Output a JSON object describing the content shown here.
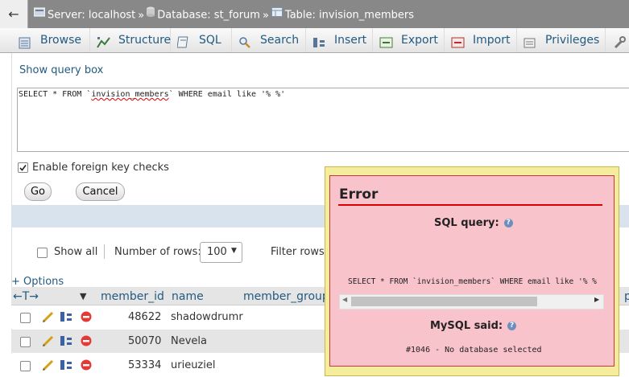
{
  "breadcrumb": {
    "server": "Server: localhost",
    "database": "Database: st_forum",
    "table": "Table: invision_members",
    "sep": "»"
  },
  "tabs": [
    {
      "label": "Browse",
      "icon": "browse-icon"
    },
    {
      "label": "Structure",
      "icon": "structure-icon"
    },
    {
      "label": "SQL",
      "icon": "sql-icon"
    },
    {
      "label": "Search",
      "icon": "search-icon"
    },
    {
      "label": "Insert",
      "icon": "insert-icon"
    },
    {
      "label": "Export",
      "icon": "export-icon"
    },
    {
      "label": "Import",
      "icon": "import-icon"
    },
    {
      "label": "Privileges",
      "icon": "privileges-icon"
    }
  ],
  "query": {
    "show_query_box": "Show query box",
    "sql_before": "SELECT * FROM `",
    "sql_table": "invision_members",
    "sql_after": "` WHERE email like '% %'",
    "fk_label": "Enable foreign key checks",
    "go_label": "Go",
    "cancel_label": "Cancel"
  },
  "nav": {
    "show_all": "Show all",
    "rows_label": "Number of rows:",
    "rows_value": "100",
    "filter_label": "Filter rows:",
    "options": "+ Options"
  },
  "table": {
    "columns": [
      "member_id",
      "name",
      "member_group_"
    ],
    "extra_col": "p",
    "rows": [
      {
        "member_id": "48622",
        "name": "shadowdrumr"
      },
      {
        "member_id": "50070",
        "name": "Nevela"
      },
      {
        "member_id": "53334",
        "name": "urieuziel"
      }
    ]
  },
  "error": {
    "title": "Error",
    "sql_query_label": "SQL query:",
    "sql_query": "SELECT * FROM `invision_members` WHERE email like '% %",
    "mysql_said_label": "MySQL said:",
    "message": "#1046 - No database selected"
  },
  "colors": {
    "link": "#235a81",
    "dialog_bg": "#f9c3cb",
    "dialog_border": "#f5ec9c",
    "error_rule": "#dd0000"
  }
}
